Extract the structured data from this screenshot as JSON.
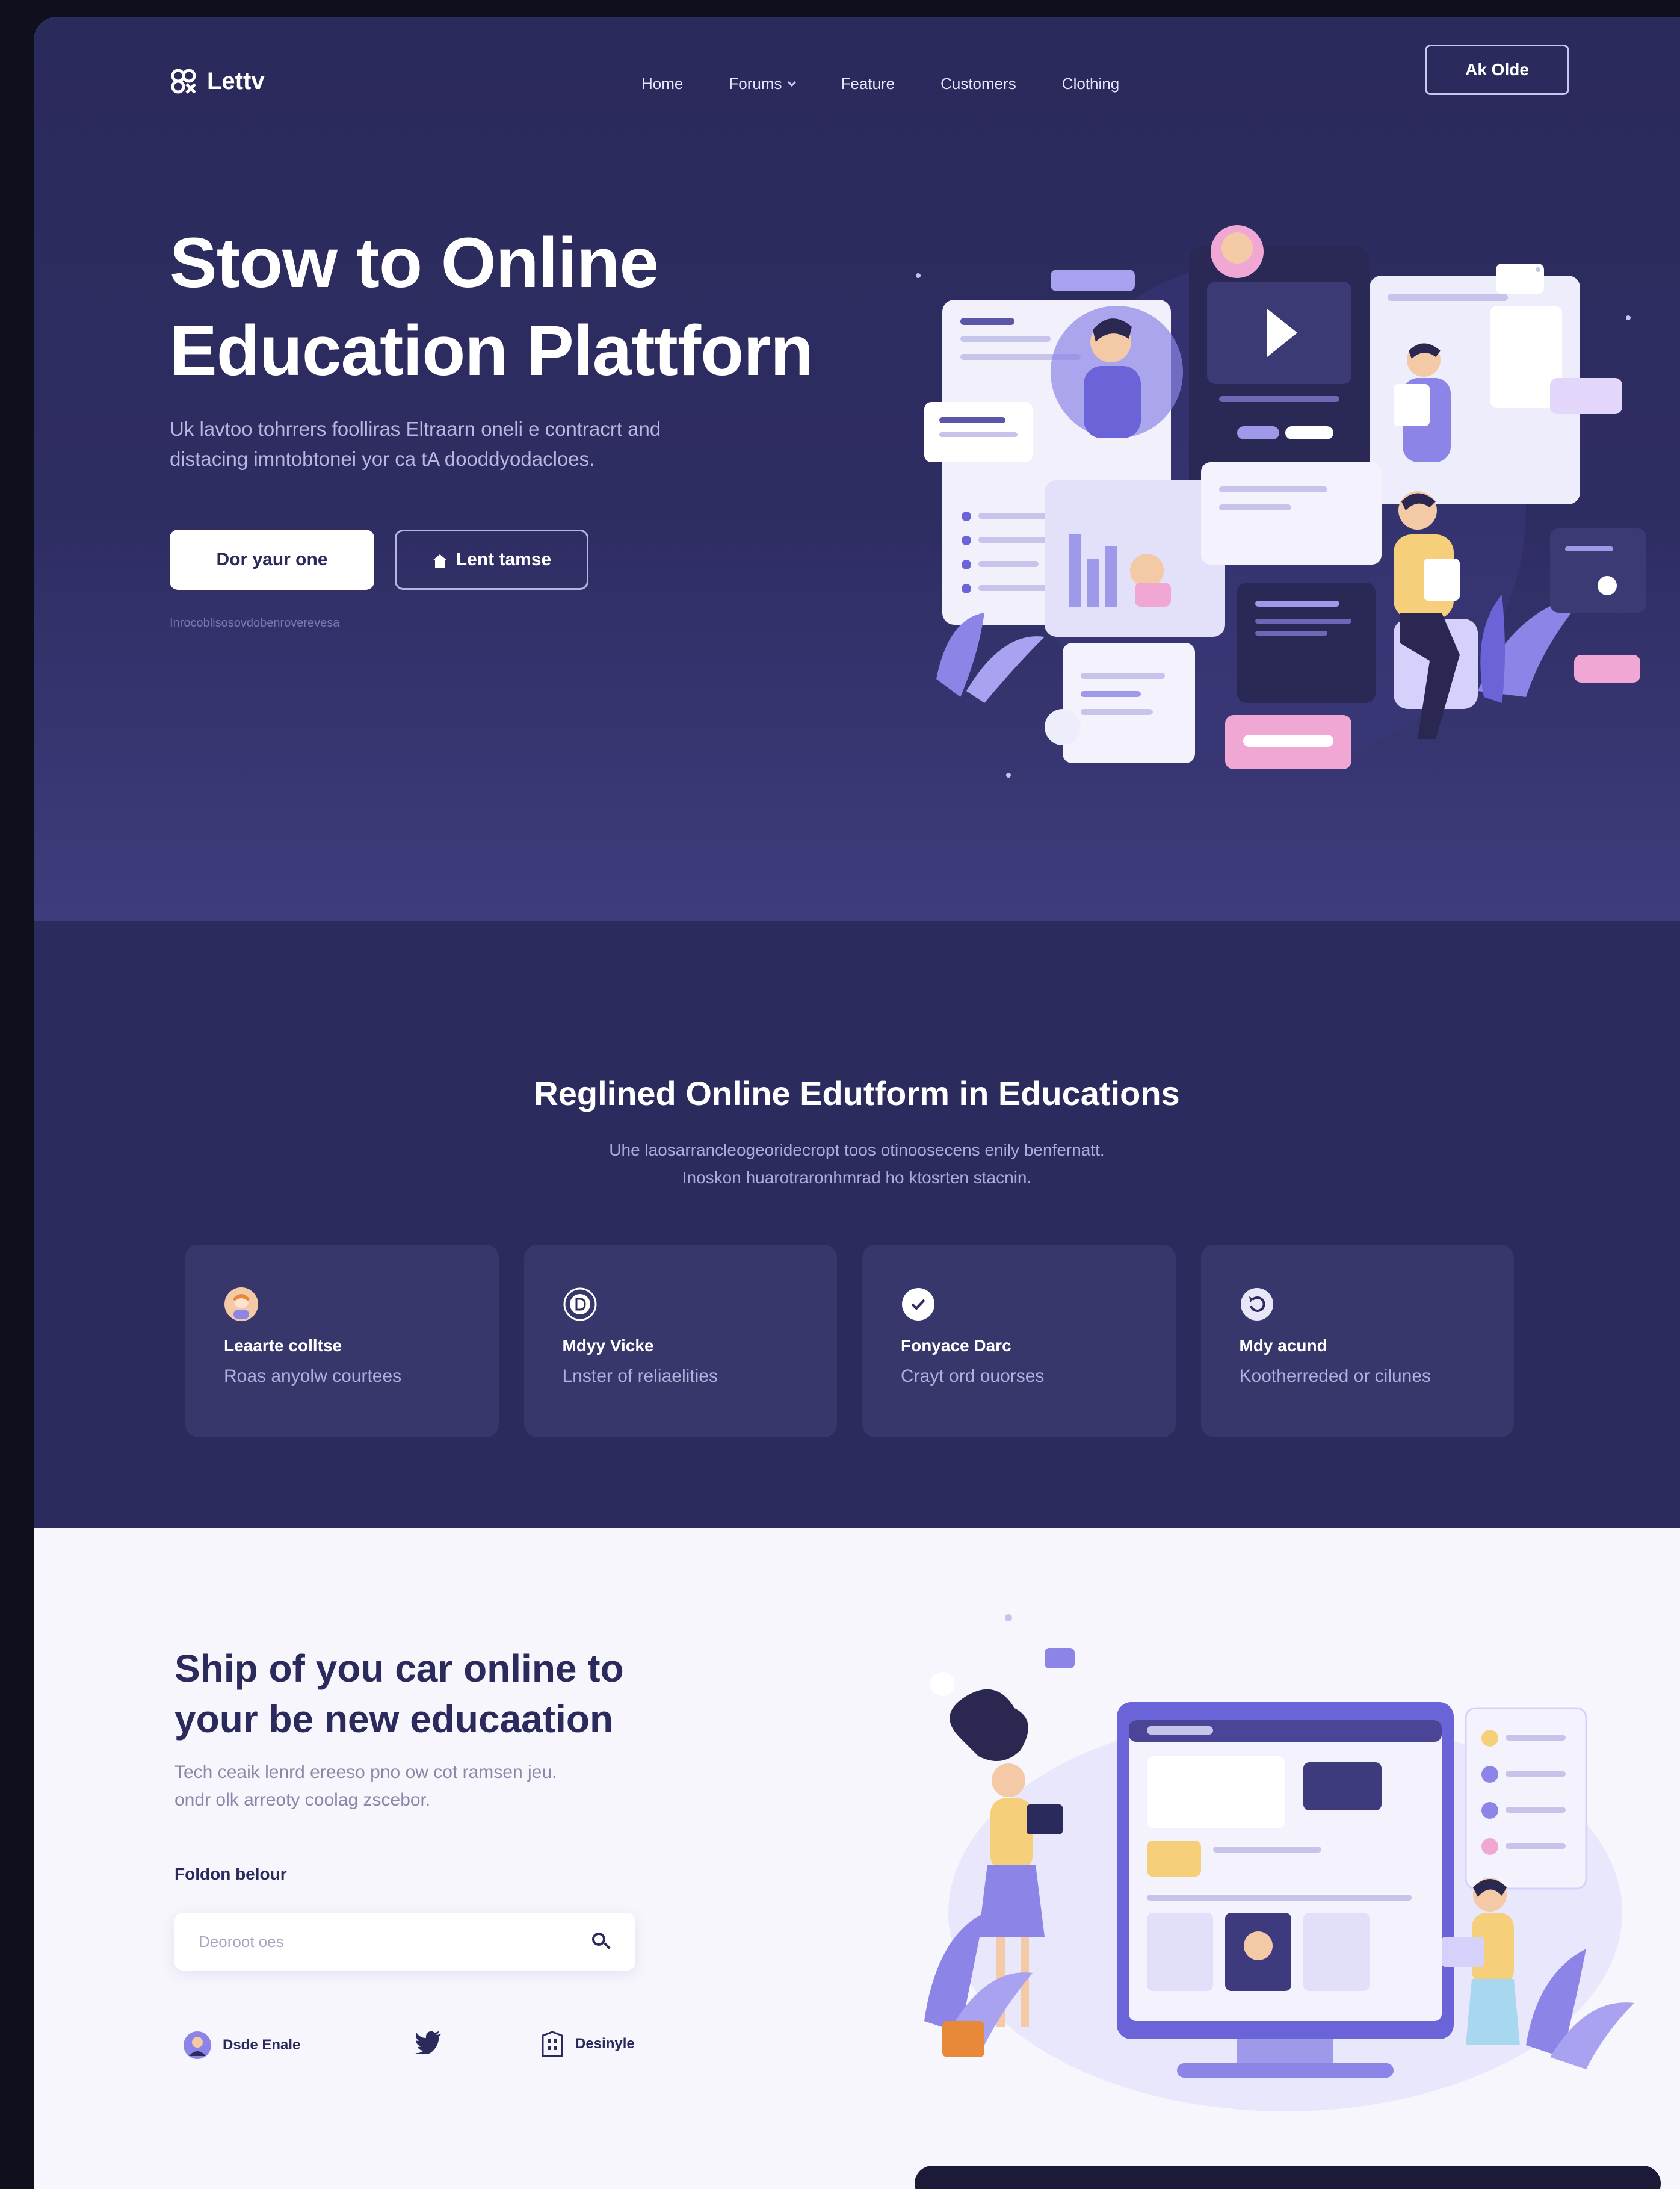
{
  "colors": {
    "hero_bg": "#2b2a5c",
    "accent": "#8c84e6",
    "pink": "#f1a7d4",
    "light_bg": "#f7f6fc"
  },
  "nav": {
    "logo": "Lettv",
    "links": [
      "Home",
      "Forums",
      "Feature",
      "Customers",
      "Clothing"
    ],
    "cta": "Ak Olde"
  },
  "hero": {
    "title_line1": "Stow to Online",
    "title_line2": "Education Plattforn",
    "desc_line1": "Uk lavtoo tohrrers foolliras Eltraarn oneli e contracrt and",
    "desc_line2": "distacing imntobtonei yor ca tA dooddyodacloes.",
    "primary_btn": "Dor yaur one",
    "secondary_btn": "Lent tamse",
    "note": "Inrocoblisosovdobenroverevesa"
  },
  "features": {
    "title": "Reglined Online Edutform in Educations",
    "sub_line1": "Uhe laosarrancleogeoridecropt toos otinoosecens enily benfernatt.",
    "sub_line2": "Inoskon huarotraronhmrad ho ktosrten stacnin.",
    "cards": [
      {
        "name": "Leaarte colltse",
        "desc": "Roas anyolw courtees",
        "icon": "avatar-icon",
        "icon_color": "#f4c9a6"
      },
      {
        "name": "Mdyy Vicke",
        "desc": "Lnster of reliaelities",
        "icon": "d-badge-icon",
        "icon_color": "#4a4888"
      },
      {
        "name": "Fonyace Darc",
        "desc": "Crayt ord ouorses",
        "icon": "check-circle-icon",
        "icon_color": "#ffffff"
      },
      {
        "name": "Mdy acund",
        "desc": "Kootherreded or cilunes",
        "icon": "refresh-icon",
        "icon_color": "#e8e6f8"
      }
    ]
  },
  "section3": {
    "title_line1": "Ship of you car online to",
    "title_line2": "your be new educaation",
    "desc_line1": "Tech ceaik lenrd ereeso pno ow cot ramsen jeu.",
    "desc_line2": "ondr olk arreoty coolag zscebor.",
    "search_label": "Foldon belour",
    "search_placeholder": "Deoroot oes",
    "social": [
      {
        "label": "Dsde Enale",
        "icon": "avatar-icon"
      },
      {
        "label": "",
        "icon": "twitter-icon"
      },
      {
        "label": "Desinyle",
        "icon": "building-icon"
      }
    ]
  }
}
